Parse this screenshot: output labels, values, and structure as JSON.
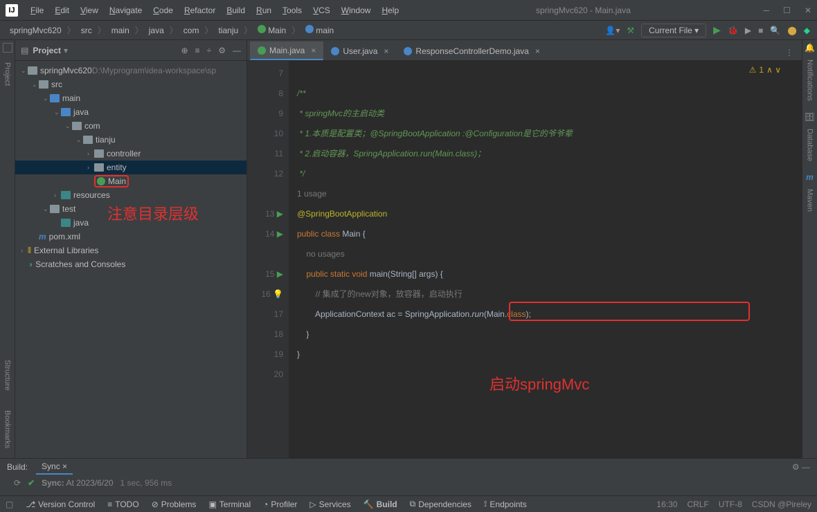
{
  "window": {
    "title": "springMvc620 - Main.java"
  },
  "menu": [
    "File",
    "Edit",
    "View",
    "Navigate",
    "Code",
    "Refactor",
    "Build",
    "Run",
    "Tools",
    "VCS",
    "Window",
    "Help"
  ],
  "breadcrumbs": [
    "springMvc620",
    "src",
    "main",
    "java",
    "com",
    "tianju",
    "Main",
    "main"
  ],
  "navbar": {
    "current_file": "Current File"
  },
  "left_tools": [
    "Project"
  ],
  "right_tools": [
    "Notifications",
    "Database",
    "Maven"
  ],
  "project_panel": {
    "title": "Project",
    "root": "springMvc620",
    "root_path": "D:\\Myprogram\\idea-workspace\\sp",
    "nodes": [
      {
        "indent": 0,
        "arrow": "v",
        "icon": "root",
        "label": "springMvc620",
        "dim_label": "D:\\Myprogram\\idea-workspace\\sp"
      },
      {
        "indent": 1,
        "arrow": "v",
        "icon": "folder",
        "label": "src"
      },
      {
        "indent": 2,
        "arrow": "v",
        "icon": "blue",
        "label": "main"
      },
      {
        "indent": 3,
        "arrow": "v",
        "icon": "blue",
        "label": "java"
      },
      {
        "indent": 4,
        "arrow": "v",
        "icon": "folder",
        "label": "com"
      },
      {
        "indent": 5,
        "arrow": "v",
        "icon": "folder",
        "label": "tianju"
      },
      {
        "indent": 6,
        "arrow": ">",
        "icon": "folder",
        "label": "controller"
      },
      {
        "indent": 6,
        "arrow": ">",
        "icon": "folder",
        "label": "entity",
        "selected": true
      },
      {
        "indent": 6,
        "arrow": "",
        "icon": "class",
        "label": "Main",
        "boxed": true
      },
      {
        "indent": 3,
        "arrow": ">",
        "icon": "teal",
        "label": "resources"
      },
      {
        "indent": 2,
        "arrow": "v",
        "icon": "folder",
        "label": "test"
      },
      {
        "indent": 3,
        "arrow": "",
        "icon": "teal",
        "label": "java"
      },
      {
        "indent": 1,
        "arrow": "",
        "icon": "maven",
        "label": "pom.xml"
      },
      {
        "indent": 0,
        "arrow": ">",
        "icon": "lib",
        "label": "External Libraries"
      },
      {
        "indent": 0,
        "arrow": "",
        "icon": "scratch",
        "label": "Scratches and Consoles"
      }
    ]
  },
  "annotations": {
    "tree_note": "注意目录层级",
    "code_note": "启动springMvc"
  },
  "tabs": [
    {
      "label": "Main.java",
      "icon": "green",
      "active": true
    },
    {
      "label": "User.java",
      "icon": "blue"
    },
    {
      "label": "ResponseControllerDemo.java",
      "icon": "blue"
    }
  ],
  "warnings": {
    "count": "1"
  },
  "code": {
    "lines": [
      {
        "n": "7",
        "html": ""
      },
      {
        "n": "8",
        "html": "<span class='cmt'>/**</span>"
      },
      {
        "n": "9",
        "html": "<span class='cmt'> * springMvc的主启动类</span>"
      },
      {
        "n": "10",
        "html": "<span class='cmt'> * 1.本质是配置类；@SpringBootApplication :@Configuration是它的爷爷辈</span>"
      },
      {
        "n": "11",
        "html": "<span class='cmt'> * 2.启动容器，SpringApplication.run(Main.class)；</span>"
      },
      {
        "n": "12",
        "html": "<span class='cmt'> */</span>"
      },
      {
        "n": "",
        "html": "<span class='hint'>1 usage</span>"
      },
      {
        "n": "13",
        "html": "<span class='ann'>@SpringBootApplication</span>",
        "run": true
      },
      {
        "n": "14",
        "html": "<span class='kw'>public class</span> Main {",
        "run": true
      },
      {
        "n": "",
        "html": "    <span class='hint'>no usages</span>"
      },
      {
        "n": "15",
        "html": "    <span class='kw'>public static void</span> <span class='cls'>main</span>(String[] args) {",
        "run": true
      },
      {
        "n": "16",
        "html": "        <span class='hint'>// 集成了的new对象，放容器，启动执行</span>",
        "bulb": true
      },
      {
        "n": "17",
        "html": "        ApplicationContext ac = SpringApplication.<span class='mth-i'>run</span>(Main.<span class='kw'>class</span>);"
      },
      {
        "n": "18",
        "html": "    }"
      },
      {
        "n": "19",
        "html": "}"
      },
      {
        "n": "20",
        "html": ""
      }
    ]
  },
  "build_panel": {
    "label": "Build:",
    "tab": "Sync",
    "status": "Sync:",
    "time": "At 2023/6/20",
    "duration": "1 sec, 956 ms"
  },
  "bottom_tools": [
    "Version Control",
    "TODO",
    "Problems",
    "Terminal",
    "Profiler",
    "Services",
    "Build",
    "Dependencies",
    "Endpoints"
  ],
  "statusbar": {
    "time": "16:30",
    "eol": "CRLF",
    "enc": "UTF-8",
    "watermark": "CSDN @Pireley"
  }
}
